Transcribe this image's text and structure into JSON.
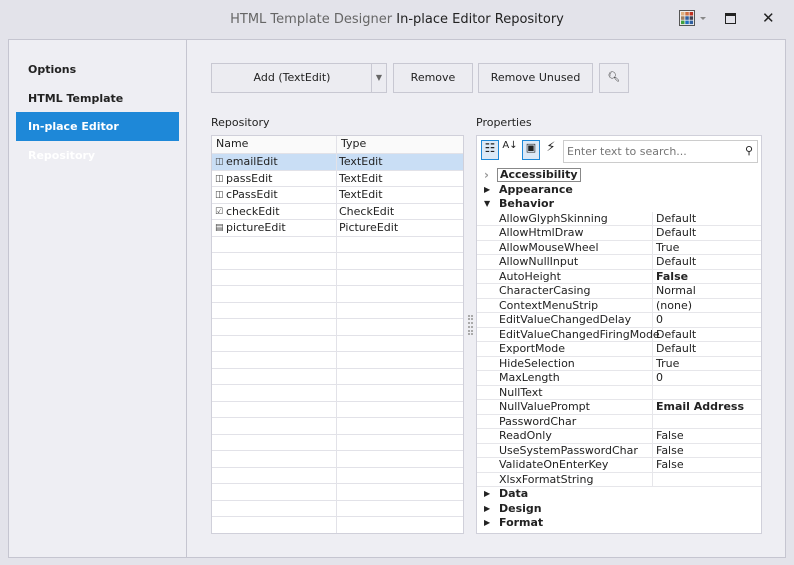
{
  "window": {
    "title_app": "HTML Template Designer",
    "title_page": "In-place Editor Repository",
    "palette_colors": [
      "#e0b080",
      "#d07040",
      "#c03020",
      "#a08060",
      "#3060a0",
      "#404050",
      "#40a040",
      "#2070c0",
      "#3060a0"
    ]
  },
  "sidebar": {
    "items": [
      {
        "label": "Options"
      },
      {
        "label": "HTML Template"
      },
      {
        "label": "In-place Editor Repository",
        "selected": true
      }
    ]
  },
  "toolbar": {
    "add_label": "Add (TextEdit)",
    "remove_label": "Remove",
    "remove_unused_label": "Remove Unused"
  },
  "repository": {
    "label": "Repository",
    "columns": [
      "Name",
      "Type"
    ],
    "rows": [
      {
        "name": "emailEdit",
        "type": "TextEdit",
        "icon": "textedit-icon",
        "selected": true
      },
      {
        "name": "passEdit",
        "type": "TextEdit",
        "icon": "textedit-icon"
      },
      {
        "name": "cPassEdit",
        "type": "TextEdit",
        "icon": "textedit-icon"
      },
      {
        "name": "checkEdit",
        "type": "CheckEdit",
        "icon": "checkbox-icon"
      },
      {
        "name": "pictureEdit",
        "type": "PictureEdit",
        "icon": "picture-icon"
      }
    ]
  },
  "properties": {
    "label": "Properties",
    "search_placeholder": "Enter text to search...",
    "categories_before": [
      {
        "name": "Accessibility",
        "expanded": false,
        "focused": true
      },
      {
        "name": "Appearance",
        "expanded": false
      },
      {
        "name": "Behavior",
        "expanded": true
      }
    ],
    "behavior": [
      {
        "name": "AllowGlyphSkinning",
        "value": "Default"
      },
      {
        "name": "AllowHtmlDraw",
        "value": "Default"
      },
      {
        "name": "AllowMouseWheel",
        "value": "True"
      },
      {
        "name": "AllowNullInput",
        "value": "Default"
      },
      {
        "name": "AutoHeight",
        "value": "False",
        "bold": true
      },
      {
        "name": "CharacterCasing",
        "value": "Normal"
      },
      {
        "name": "ContextMenuStrip",
        "value": "(none)"
      },
      {
        "name": "EditValueChangedDelay",
        "value": "0"
      },
      {
        "name": "EditValueChangedFiringMode",
        "value": "Default"
      },
      {
        "name": "ExportMode",
        "value": "Default"
      },
      {
        "name": "HideSelection",
        "value": "True"
      },
      {
        "name": "MaxLength",
        "value": "0"
      },
      {
        "name": "NullText",
        "value": ""
      },
      {
        "name": "NullValuePrompt",
        "value": "Email Address",
        "bold": true
      },
      {
        "name": "PasswordChar",
        "value": ""
      },
      {
        "name": "ReadOnly",
        "value": "False"
      },
      {
        "name": "UseSystemPasswordChar",
        "value": "False"
      },
      {
        "name": "ValidateOnEnterKey",
        "value": "False"
      },
      {
        "name": "XlsxFormatString",
        "value": ""
      }
    ],
    "categories_after": [
      {
        "name": "Data"
      },
      {
        "name": "Design"
      },
      {
        "name": "Format"
      }
    ]
  }
}
